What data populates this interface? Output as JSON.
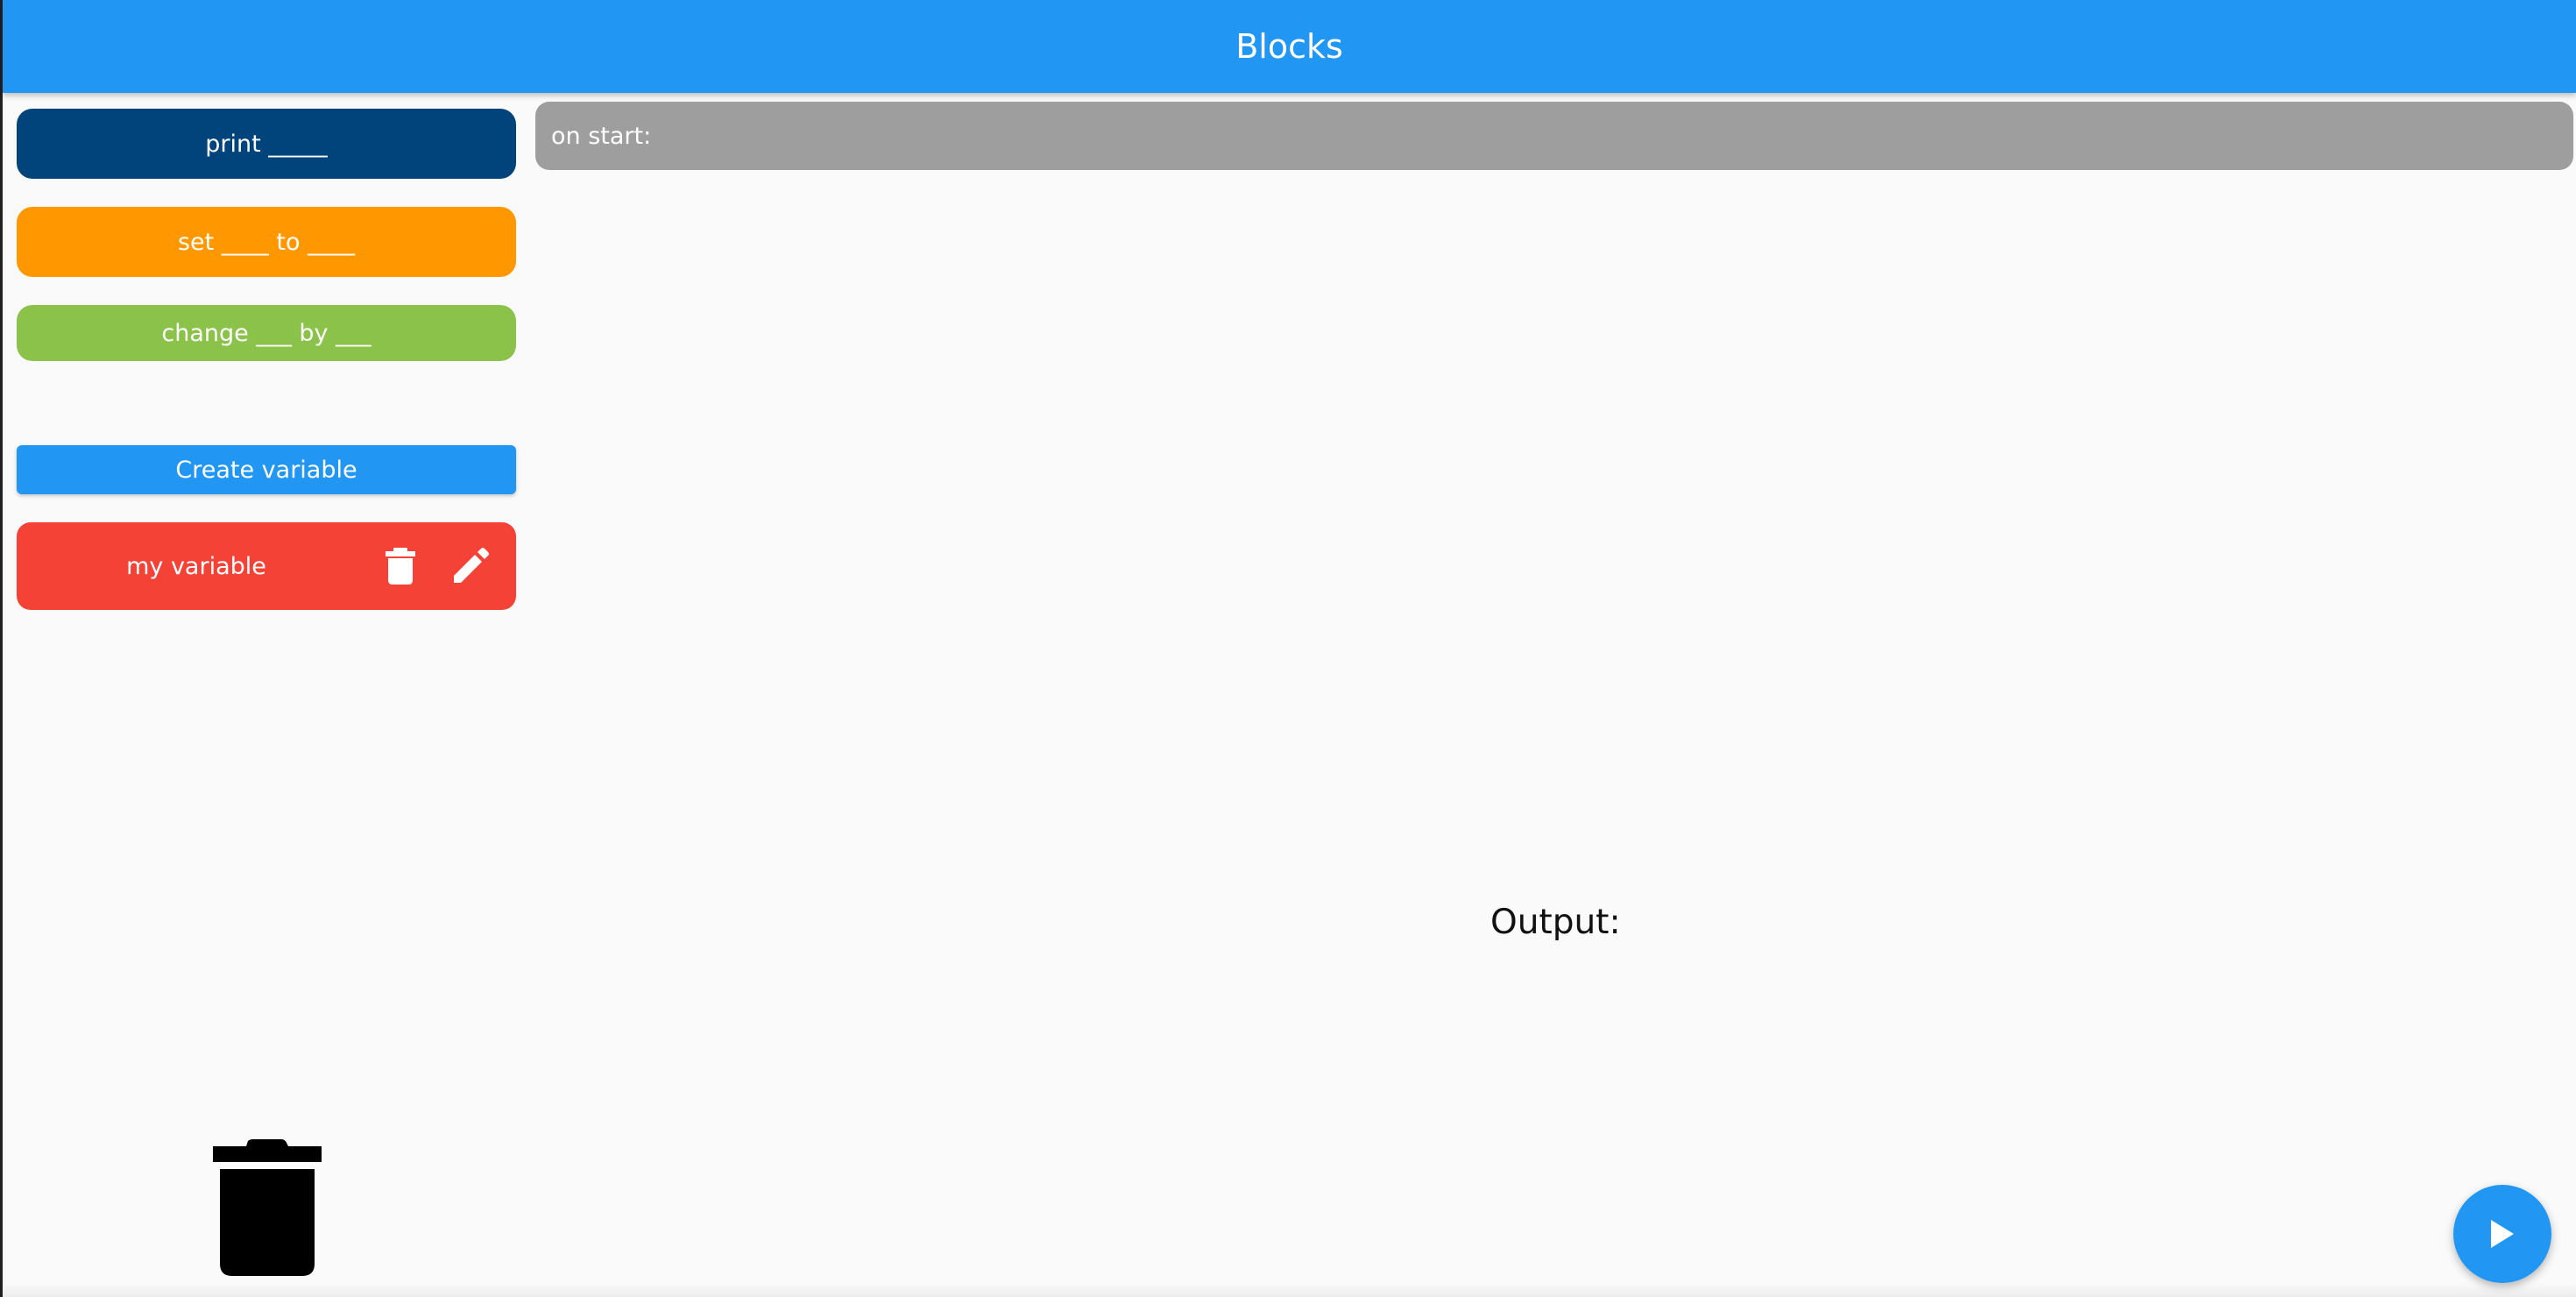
{
  "appbar": {
    "title": "Blocks"
  },
  "palette": {
    "print_label": "print _____",
    "set_label": "set ____ to ____",
    "change_label": "change ___ by ___"
  },
  "variables": {
    "create_label": "Create variable",
    "items": [
      {
        "name": "my variable"
      }
    ]
  },
  "workspace": {
    "start_label": "on start:"
  },
  "output": {
    "label": "Output:"
  },
  "colors": {
    "appbar": "#2196f3",
    "print_block": "#01447c",
    "set_block": "#ff9800",
    "change_block": "#8bc34a",
    "variable_block": "#f44336",
    "start_block": "#9e9e9e",
    "fab": "#2196f3"
  },
  "icons": {
    "variable_delete": "trash-icon",
    "variable_edit": "pencil-icon",
    "drop_zone": "trash-can-icon",
    "run": "play-icon"
  }
}
